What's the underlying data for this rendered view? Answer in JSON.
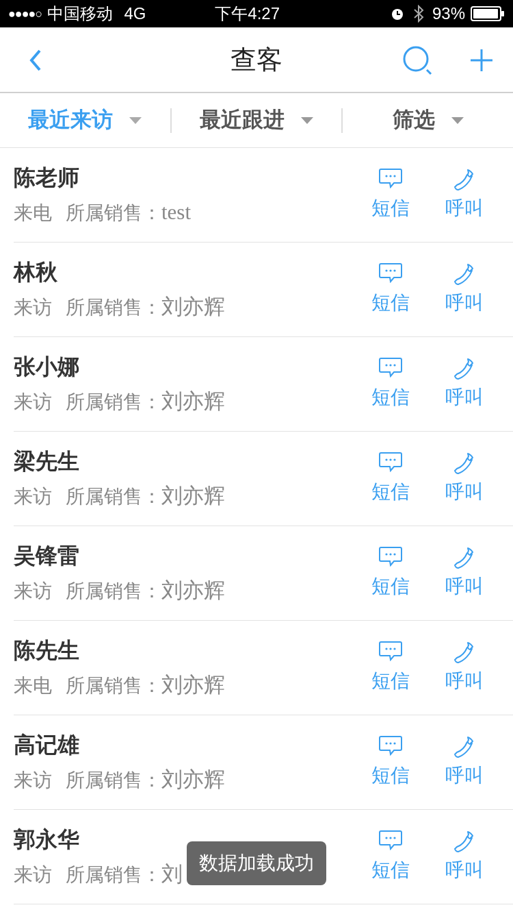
{
  "status_bar": {
    "signal": "●●●●○",
    "carrier": "中国移动",
    "network": "4G",
    "time": "下午4:27",
    "battery_percent": "93%"
  },
  "nav": {
    "title": "查客"
  },
  "filters": [
    {
      "label": "最近来访",
      "selected": true
    },
    {
      "label": "最近跟进",
      "selected": false
    },
    {
      "label": "筛选",
      "selected": false
    }
  ],
  "customers": [
    {
      "name": "陈老师",
      "source": "来电",
      "sales_label": "所属销售：",
      "sales": "test",
      "sms": "短信",
      "call": "呼叫"
    },
    {
      "name": "林秋",
      "source": "来访",
      "sales_label": "所属销售：",
      "sales": "刘亦辉",
      "sms": "短信",
      "call": "呼叫"
    },
    {
      "name": "张小娜",
      "source": "来访",
      "sales_label": "所属销售：",
      "sales": "刘亦辉",
      "sms": "短信",
      "call": "呼叫"
    },
    {
      "name": "梁先生",
      "source": "来访",
      "sales_label": "所属销售：",
      "sales": "刘亦辉",
      "sms": "短信",
      "call": "呼叫"
    },
    {
      "name": "吴锋雷",
      "source": "来访",
      "sales_label": "所属销售：",
      "sales": "刘亦辉",
      "sms": "短信",
      "call": "呼叫"
    },
    {
      "name": "陈先生",
      "source": "来电",
      "sales_label": "所属销售：",
      "sales": "刘亦辉",
      "sms": "短信",
      "call": "呼叫"
    },
    {
      "name": "高记雄",
      "source": "来访",
      "sales_label": "所属销售：",
      "sales": "刘亦辉",
      "sms": "短信",
      "call": "呼叫"
    },
    {
      "name": "郭永华",
      "source": "来访",
      "sales_label": "所属销售：",
      "sales": "刘",
      "sms": "短信",
      "call": "呼叫"
    }
  ],
  "toast": "数据加载成功"
}
